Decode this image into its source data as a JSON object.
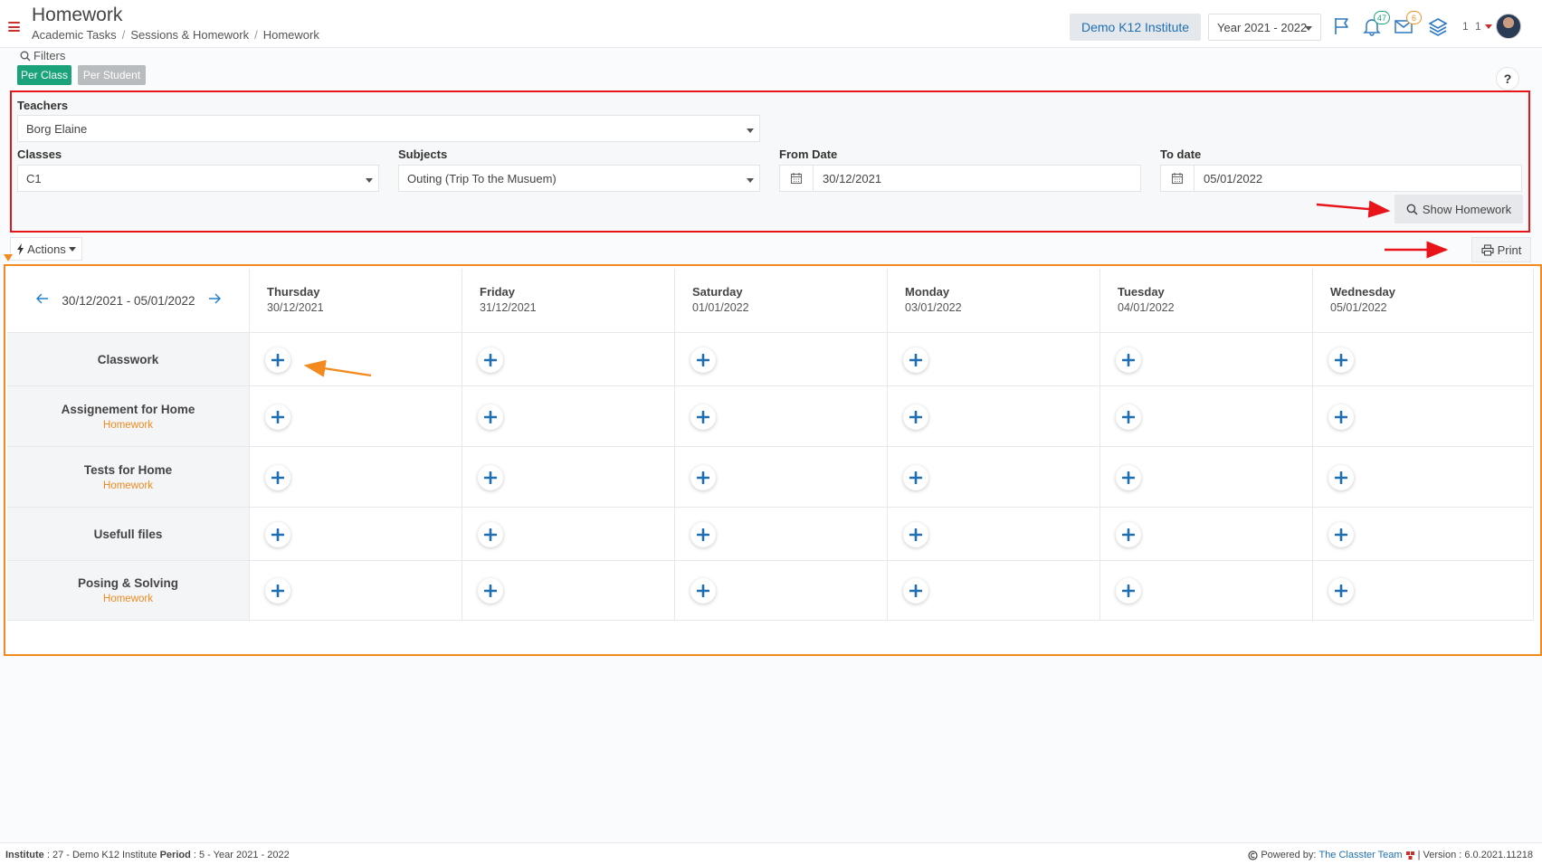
{
  "header": {
    "title": "Homework",
    "breadcrumb": [
      "Academic Tasks",
      "Sessions & Homework",
      "Homework"
    ],
    "institute": "Demo K12 Institute",
    "year": "Year 2021 - 2022",
    "notifications_count": "47",
    "messages_count": "6",
    "user_index": "1 1"
  },
  "filters": {
    "label": "Filters",
    "per_class": "Per Class",
    "per_student": "Per Student",
    "help": "?",
    "teachers_label": "Teachers",
    "teachers_value": "Borg Elaine",
    "classes_label": "Classes",
    "classes_value": "C1",
    "subjects_label": "Subjects",
    "subjects_value": "Outing (Trip To the Musuem)",
    "from_label": "From Date",
    "from_value": "30/12/2021",
    "to_label": "To date",
    "to_value": "05/01/2022",
    "show_button": "Show Homework"
  },
  "toolbar": {
    "actions": "Actions",
    "print": "Print"
  },
  "schedule": {
    "range": "30/12/2021 - 05/01/2022",
    "days": [
      {
        "name": "Thursday",
        "date": "30/12/2021"
      },
      {
        "name": "Friday",
        "date": "31/12/2021"
      },
      {
        "name": "Saturday",
        "date": "01/01/2022"
      },
      {
        "name": "Monday",
        "date": "03/01/2022"
      },
      {
        "name": "Tuesday",
        "date": "04/01/2022"
      },
      {
        "name": "Wednesday",
        "date": "05/01/2022"
      }
    ],
    "rows": [
      {
        "title": "Classwork",
        "sub": ""
      },
      {
        "title": "Assignement for Home",
        "sub": "Homework"
      },
      {
        "title": "Tests for Home",
        "sub": "Homework"
      },
      {
        "title": "Usefull files",
        "sub": ""
      },
      {
        "title": "Posing & Solving",
        "sub": "Homework"
      }
    ]
  },
  "footer": {
    "institute_label": "Institute",
    "institute_value": ": 27 - Demo K12 Institute",
    "period_label": "Period",
    "period_value": ": 5 - Year 2021 - 2022",
    "powered_by": "Powered by:",
    "team": "The Classter Team",
    "version": "| Version : 6.0.2021.11218"
  },
  "colors": {
    "accent": "#1aa37a",
    "link": "#1f6fb2",
    "annotation_red": "#e8141a",
    "annotation_orange": "#f28a1f"
  }
}
